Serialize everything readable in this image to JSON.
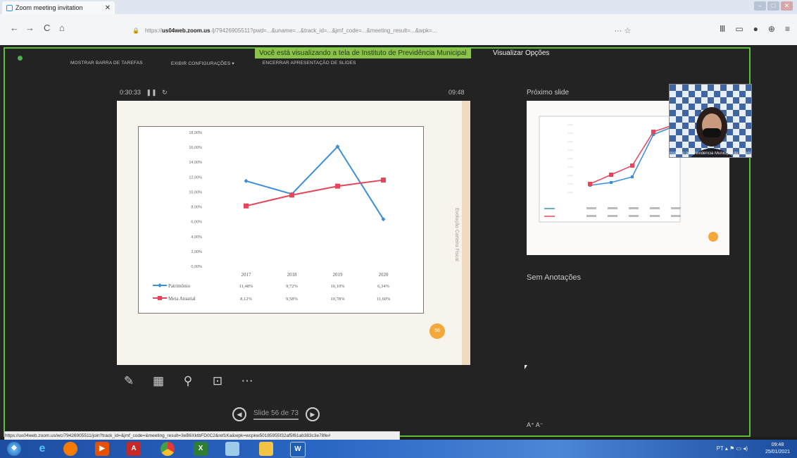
{
  "browser": {
    "tab_title": "Zoom meeting invitation",
    "tab_close": "✕",
    "url_host": "us04web.zoom.us",
    "url_prefix": "https://",
    "url_rest": "/j/79426905511?pwd=...&uname=...&track_id=...&jmf_code=...&meeting_result=...&wpk=...",
    "more": "··· ☆",
    "nav": {
      "back": "←",
      "forward": "→",
      "reload": "C",
      "home": "⌂"
    }
  },
  "zoom": {
    "share_banner": "Você está visualizando a tela de Instituto de Previdência Municipal",
    "view_options": "Visualizar Opções",
    "toolbar": [
      "MOSTRAR BARRA DE TAREFAS",
      "EXIBIR CONFIGURAÇÕES ▾",
      "ENCERRAR APRESENTAÇÃO DE SLIDES"
    ],
    "timer": "0:30:33",
    "clock": "09:48",
    "next_slide_label": "Próximo slide",
    "notes": "Sem Anotações",
    "slide_counter": "Slide 56 de 73",
    "page_badge": "56",
    "slide_side_text": "Evolução     Carteira Fiscal",
    "font_size_controls": "A⁺  A⁻",
    "participant_name": "Instituto de Previdência Municipal de Uberlândia",
    "status_url": "https://us04web.zoom.us/wc/79426905511/join?track_id=&jmf_code=&meeting_result=3eB6XktbFD0C2&ref1Ka&wpk=wcpkw50185955f32af5f61ab383c3e78fe#"
  },
  "chart_data": {
    "type": "line",
    "categories": [
      "2017",
      "2018",
      "2019",
      "2020"
    ],
    "ylim": [
      0,
      18
    ],
    "yticks": [
      "0,00%",
      "2,00%",
      "4,00%",
      "6,00%",
      "8,00%",
      "10,00%",
      "12,00%",
      "14,00%",
      "16,00%",
      "18,00%"
    ],
    "series": [
      {
        "name": "Patrimônio",
        "values": [
          11.48,
          9.72,
          16.1,
          6.34
        ],
        "labels": [
          "11,48%",
          "9,72%",
          "16,10%",
          "6,34%"
        ],
        "color": "#3b8ed8"
      },
      {
        "name": "Meta Atuarial",
        "values": [
          8.12,
          9.58,
          10.78,
          11.6
        ],
        "labels": [
          "8,12%",
          "9,58%",
          "10,78%",
          "11,60%"
        ],
        "color": "#e8455a"
      }
    ]
  },
  "taskbar": {
    "clock_time": "09:48",
    "clock_date": "25/01/2021",
    "tray": "PT ▴ ⚑ ▭ ◂)"
  }
}
